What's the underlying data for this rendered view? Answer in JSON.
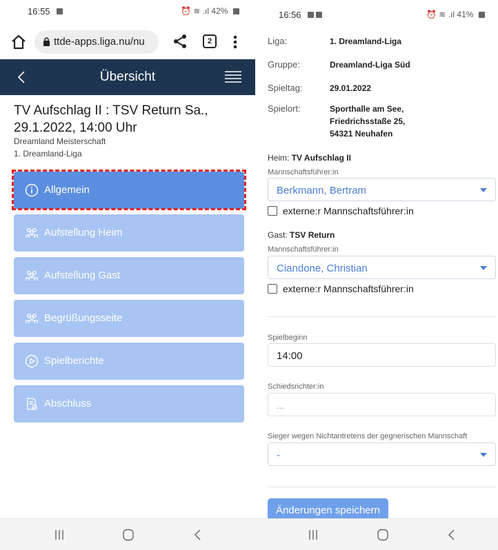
{
  "left": {
    "status": {
      "time": "16:55",
      "icons": "42%"
    },
    "browser": {
      "url": "ttde-apps.liga.nu/nu",
      "tab_count": "2"
    },
    "header": {
      "title": "Übersicht"
    },
    "match": {
      "title": "TV Aufschlag II : TSV Return Sa., 29.1.2022, 14:00 Uhr",
      "competition": "Dreamland Meisterschaft",
      "league": "1. Dreamland-Liga"
    },
    "nav": {
      "allgemein": "Allgemein",
      "aufstellung_heim": "Aufstellung Heim",
      "aufstellung_gast": "Aufstellung Gast",
      "begruessung": "Begrüßungsseite",
      "spielberichte": "Spielberichte",
      "abschluss": "Abschluss"
    }
  },
  "right": {
    "status": {
      "time": "16:56",
      "icons": "41%"
    },
    "info": [
      {
        "label": "Liga:",
        "value": "1. Dreamland-Liga"
      },
      {
        "label": "Gruppe:",
        "value": "Dreamland-Liga Süd"
      },
      {
        "label": "Spieltag:",
        "value": "29.01.2022"
      },
      {
        "label": "Spielort:",
        "value": "Sporthalle am See,\nFriedrichsstaße 25,\n54321 Neuhafen"
      }
    ],
    "heim": {
      "prefix": "Heim:",
      "team": "TV Aufschlag II",
      "captain_label": "Mannschaftsführer:in",
      "captain": "Berkmann, Bertram",
      "external_label": "externe:r Mannschaftsführer:in"
    },
    "gast": {
      "prefix": "Gast:",
      "team": "TSV Return",
      "captain_label": "Mannschaftsführer:in",
      "captain": "Ciandone, Christian",
      "external_label": "externe:r Mannschaftsführer:in"
    },
    "spielbeginn": {
      "label": "Spielbeginn",
      "value": "14:00"
    },
    "schiedsrichter": {
      "label": "Schiedsrichter:in",
      "placeholder": "..."
    },
    "sieger": {
      "label": "Sieger wegen Nichtantretens der gegnerischen Mannschaft",
      "value": "-"
    },
    "save_label": "Änderungen speichern"
  },
  "colors": {
    "header_bg": "#1d3550",
    "button_active": "#5b8ee0",
    "button_inactive": "#a7c4f2",
    "select_text": "#4a7fd4",
    "highlight": "#e02020"
  }
}
